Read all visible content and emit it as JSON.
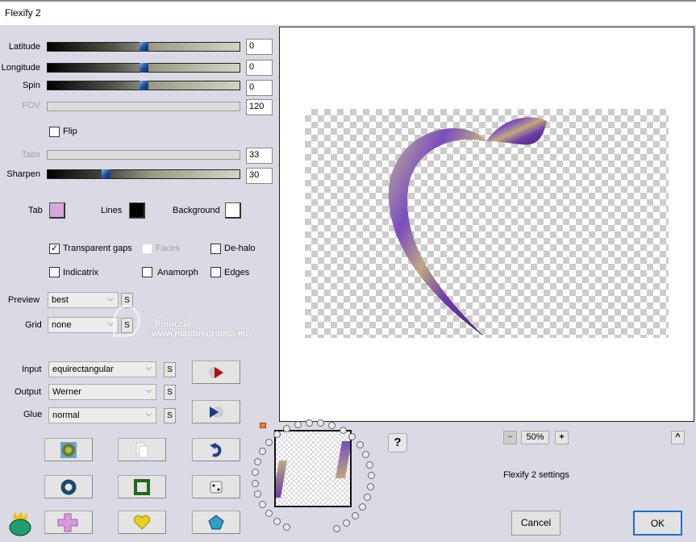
{
  "window": {
    "title": "Flexify 2"
  },
  "sliders": [
    {
      "label": "Latitude",
      "value": "0",
      "position": 0.5,
      "enabled": true
    },
    {
      "label": "Longitude",
      "value": "0",
      "position": 0.5,
      "enabled": true
    },
    {
      "label": "Spin",
      "value": "0",
      "position": 0.5,
      "enabled": true
    },
    {
      "label": "FOV",
      "value": "120",
      "enabled": false
    },
    {
      "label": "Tabs",
      "value": "33",
      "enabled": false
    },
    {
      "label": "Sharpen",
      "value": "30",
      "position": 0.3,
      "enabled": true
    }
  ],
  "flip": {
    "label": "Flip",
    "checked": false
  },
  "colors": {
    "tab_label": "Tab",
    "tab": "#d8a8dc",
    "lines_label": "Lines",
    "lines": "#000000",
    "background_label": "Background",
    "background": "#ffffff"
  },
  "options": [
    {
      "label": "Transparent gaps",
      "checked": true,
      "enabled": true
    },
    {
      "label": "Faces",
      "checked": false,
      "enabled": false
    },
    {
      "label": "De-halo",
      "checked": false,
      "enabled": true
    },
    {
      "label": "Indicatrix",
      "checked": false,
      "enabled": true
    },
    {
      "label": "Anamorph",
      "checked": false,
      "enabled": true
    },
    {
      "label": "Edges",
      "checked": false,
      "enabled": true
    }
  ],
  "preview_select": {
    "label": "Preview",
    "value": "best"
  },
  "grid_select": {
    "label": "Grid",
    "value": "none"
  },
  "input_select": {
    "label": "Input",
    "value": "equirectangular"
  },
  "output_select": {
    "label": "Output",
    "value": "Werner"
  },
  "glue_select": {
    "label": "Glue",
    "value": "normal"
  },
  "s_label": "S",
  "watermark": {
    "name": "Pinuccia",
    "url": "www.maidiregrafica.eu"
  },
  "zoom": {
    "value": "50%",
    "minus": "−",
    "plus": "+",
    "collapse": "^"
  },
  "help": "?",
  "status": "Flexify 2 settings",
  "buttons": {
    "cancel": "Cancel",
    "ok": "OK"
  }
}
